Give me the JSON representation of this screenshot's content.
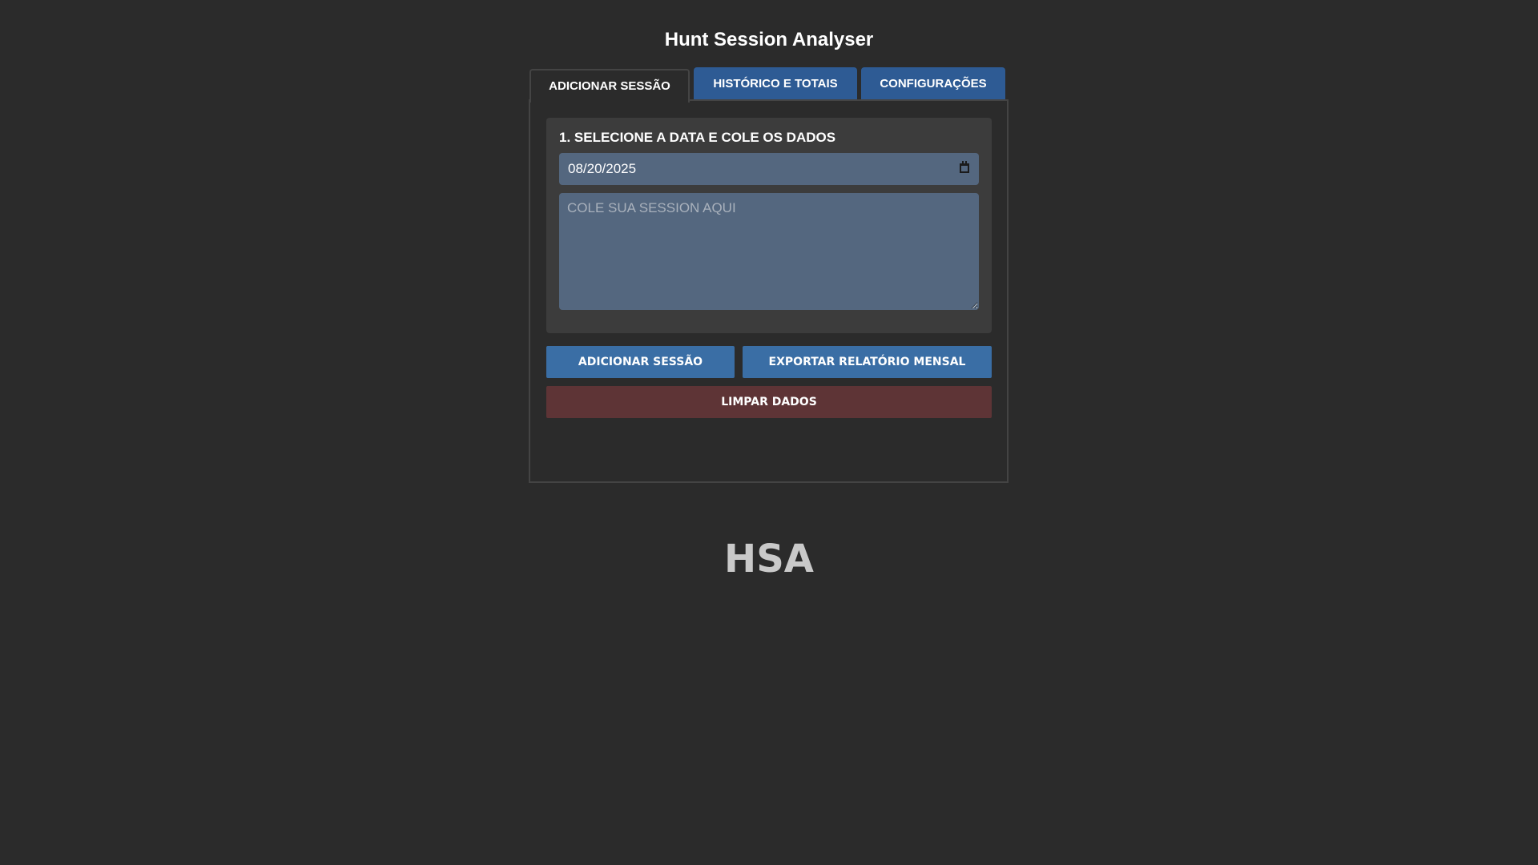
{
  "app": {
    "title": "Hunt Session Analyser",
    "logo_text": "HSA"
  },
  "tabs": [
    {
      "label": "ADICIONAR SESSÃO",
      "active": true
    },
    {
      "label": "HISTÓRICO E TOTAIS",
      "active": false
    },
    {
      "label": "CONFIGURAÇÕES",
      "active": false
    }
  ],
  "form": {
    "section_title": "1. SELECIONE A DATA E COLE OS DADOS",
    "date_value": "08/20/2025",
    "date_icon": "calendar-icon",
    "session_placeholder": "COLE SUA SESSION AQUI",
    "session_value": ""
  },
  "actions": {
    "add_label": "ADICIONAR SESSÃO",
    "export_label": "EXPORTAR RELATÓRIO MENSAL",
    "clear_label": "LIMPAR DADOS"
  },
  "colors": {
    "background": "#2b2b2b",
    "tab_inactive": "#2e5b94",
    "button_primary": "#3a6ea5",
    "button_danger": "#5e3436",
    "input_background": "#54677f",
    "card_background": "#3c3c3c"
  }
}
